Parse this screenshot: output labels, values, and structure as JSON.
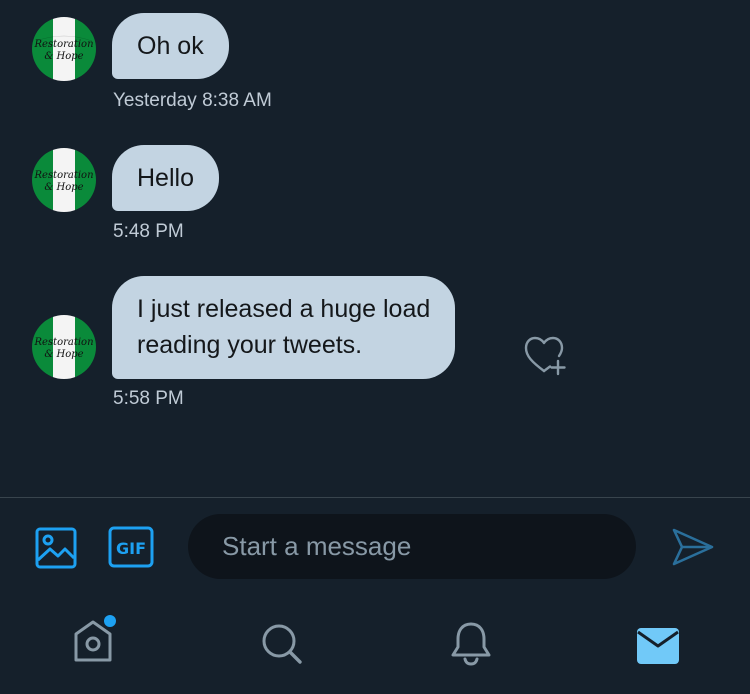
{
  "conversation": {
    "messages": [
      {
        "text_lines": [
          "Oh ok"
        ],
        "time": "Yesterday 8:38 AM"
      },
      {
        "text_lines": [
          "Hello"
        ],
        "time": "5:48 PM"
      },
      {
        "text_lines": [
          "I just released a huge load",
          "reading your tweets."
        ],
        "time": "5:58 PM"
      }
    ],
    "avatar": {
      "lettering": [
        "Restoration",
        "& Hope"
      ],
      "flag_colors": [
        "#0a8a3a",
        "#ffffff",
        "#0a8a3a"
      ]
    }
  },
  "composer": {
    "placeholder": "Start a message",
    "media_icon": "image-icon",
    "gif_label": "GIF",
    "send_icon": "send-icon"
  },
  "nav": {
    "items": [
      {
        "icon": "home-icon",
        "has_notification_dot": true
      },
      {
        "icon": "search-icon"
      },
      {
        "icon": "bell-icon"
      },
      {
        "icon": "mail-icon",
        "active": true
      }
    ]
  },
  "colors": {
    "background": "#15202b",
    "bubble": "#c3d4e2",
    "accent": "#1da1f2",
    "nav_icon": "#8899a6",
    "active_icon": "#71c9f8"
  }
}
